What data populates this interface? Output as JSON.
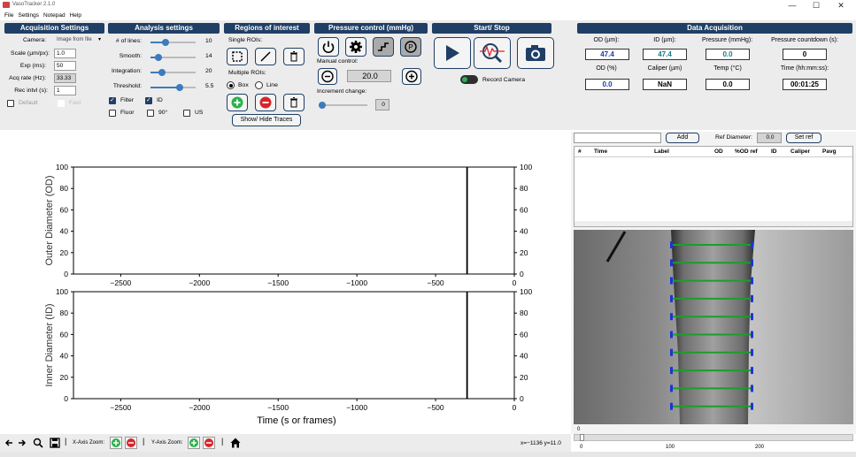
{
  "window": {
    "title": "VasoTracker 2.1.0",
    "minimize": "—",
    "maximize": "☐",
    "close": "✕"
  },
  "menu": [
    "File",
    "Settings",
    "Notepad",
    "Help"
  ],
  "acquisition": {
    "header": "Acquisition Settings",
    "camera_label": "Camera:",
    "camera_value": "Image from file",
    "scale_label": "Scale (µm/px):",
    "scale_value": "1.0",
    "exp_label": "Exp (ms):",
    "exp_value": "50",
    "acq_label": "Acq rate (Hz):",
    "acq_value": "33.33",
    "rec_label": "Rec intvl (s):",
    "rec_value": "1",
    "default_label": "Default",
    "fast_label": "Fast"
  },
  "analysis": {
    "header": "Analysis settings",
    "lines_label": "# of lines:",
    "lines_value": "10",
    "smooth_label": "Smooth:",
    "smooth_value": "14",
    "integration_label": "Integration:",
    "integration_value": "20",
    "threshold_label": "Threshold:",
    "threshold_value": "5.5",
    "filter_label": "Filter",
    "id_label": "ID",
    "fluor_label": "Fluor",
    "ninety_label": "90°",
    "us_label": "US"
  },
  "roi": {
    "header": "Regions of interest",
    "single_label": "Single ROIs:",
    "multiple_label": "Multiple ROIs:",
    "box_label": "Box",
    "line_label": "Line",
    "show_hide_label": "Show/ Hide Traces"
  },
  "pressure": {
    "header": "Pressure control (mmHg)",
    "manual_label": "Manual control:",
    "manual_value": "20.0",
    "increment_label": "Increment change:",
    "increment_value": "0"
  },
  "startstop": {
    "header": "Start/ Stop",
    "record_label": "Record Camera"
  },
  "daq": {
    "header": "Data Acquisition",
    "od_label": "OD (µm):",
    "od_value": "47.4",
    "id_label": "ID (µm):",
    "id_value": "47.4",
    "pressure_label": "Pressure (mmHg):",
    "pressure_value": "0.0",
    "countdown_label": "Pressure countdown (s):",
    "countdown_value": "0",
    "odpct_label": "OD (%)",
    "odpct_value": "0.0",
    "caliper_label": "Caliper (µm)",
    "caliper_value": "NaN",
    "temp_label": "Temp (°C)",
    "temp_value": "0.0",
    "time_label": "Time (hh:mm:ss):",
    "time_value": "00:01:25"
  },
  "table": {
    "add_label": "Add",
    "ref_label": "Ref Diameter:",
    "ref_value": "0.0",
    "setref_label": "Set ref",
    "columns": [
      "#",
      "Time",
      "Label",
      "OD",
      "%OD ref",
      "ID",
      "Caliper",
      "Pavg"
    ]
  },
  "slider": {
    "start": "0",
    "ticks": [
      "0",
      "100",
      "200"
    ]
  },
  "bottom": {
    "xzoom": "X-Axis Zoom:",
    "yzoom": "Y-Axis Zoom:",
    "coords": "x=−1136  y=11.0"
  },
  "chart_data": [
    {
      "type": "line",
      "ylabel": "Outer Diameter (OD)",
      "xlabel": "",
      "xlim": [
        -2800,
        0
      ],
      "ylim": [
        0,
        100
      ],
      "xticks": [
        -2500,
        -2000,
        -1500,
        -1000,
        -500,
        0
      ],
      "yticks": [
        0,
        20,
        40,
        60,
        80,
        100
      ],
      "vline_x": -300,
      "series": []
    },
    {
      "type": "line",
      "ylabel": "Inner Diameter (ID)",
      "xlabel": "Time (s or frames)",
      "xlim": [
        -2800,
        0
      ],
      "ylim": [
        0,
        100
      ],
      "xticks": [
        -2500,
        -2000,
        -1500,
        -1000,
        -500,
        0
      ],
      "yticks": [
        0,
        20,
        40,
        60,
        80,
        100
      ],
      "vline_x": -300,
      "series": []
    }
  ],
  "colors": {
    "header_bg": "#1f3f66",
    "value_blue": "#1a3da6",
    "value_teal": "#1a7a8a",
    "roi_green": "#1a9e2a",
    "roi_blue": "#1a35d4"
  }
}
